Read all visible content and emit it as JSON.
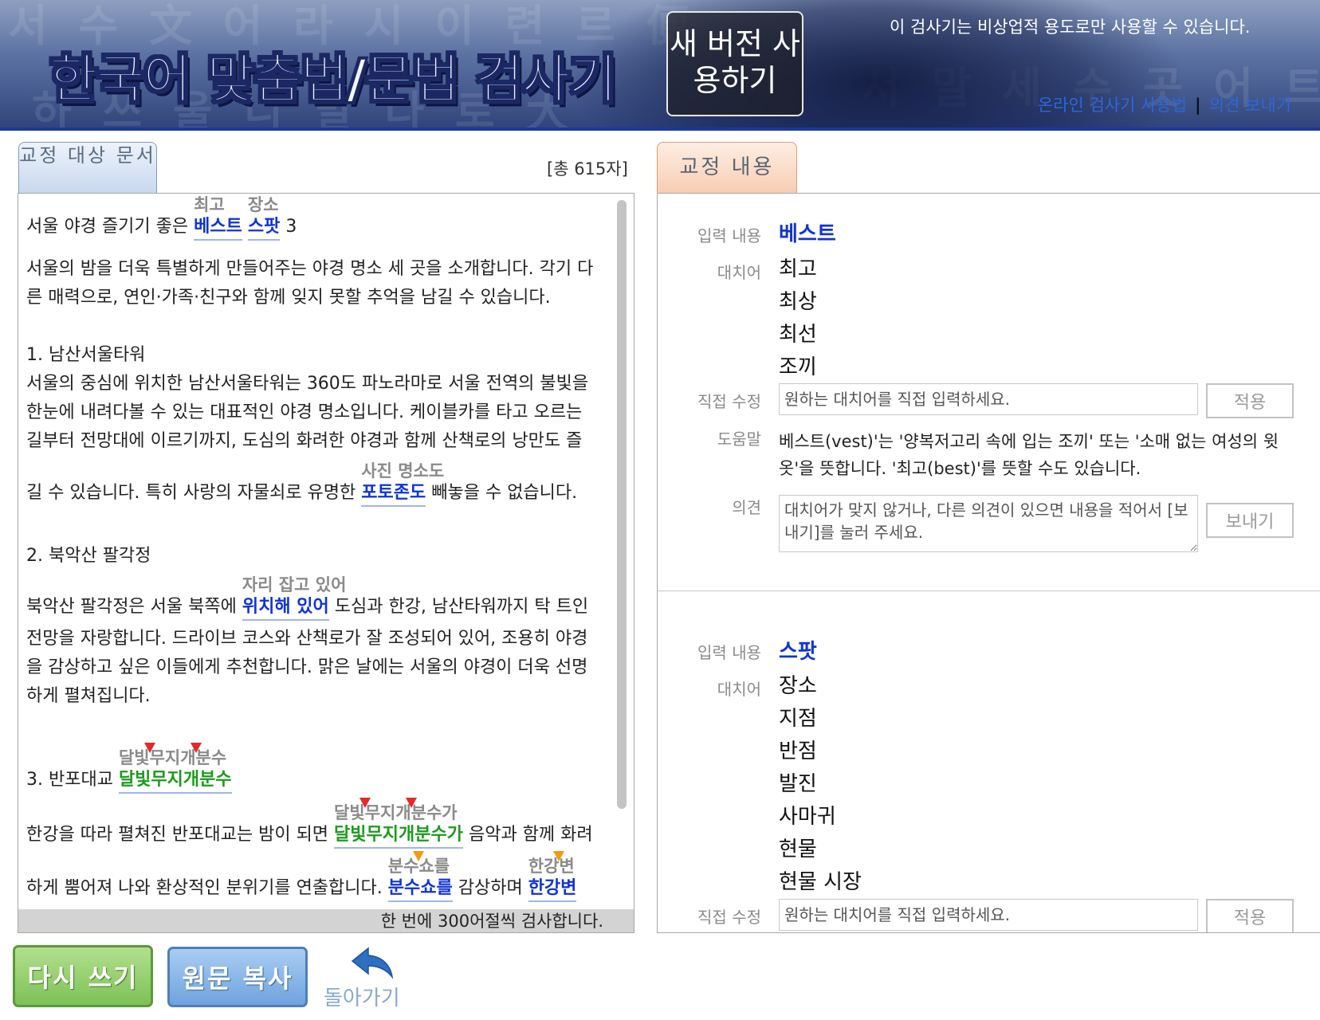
{
  "header": {
    "title": "한국어 맞춤법/문법 검사기",
    "new_version_button": "새 버전 사용하기",
    "notice": "이 검사기는 비상업적 용도로만 사용할 수 있습니다.",
    "links": {
      "usage": "온라인 검사기 사용법",
      "separator": "|",
      "feedback": "의견 보내기"
    },
    "background_text": [
      "서 수 文 어 라 시 이 련 르 便",
      "하 쓰 울 니 말 다 로 大",
      "서 말 세 수 곳 어 트 편"
    ]
  },
  "left": {
    "tab_label": "교정 대상 문서",
    "char_count": "[총 615자]",
    "footer": "한 번에 300어절씩 검사합니다.",
    "lines": {
      "l1_pre": "서울 야경 즐기기 좋은 ",
      "l1_err1": "베스트",
      "l1_sug1": "최고",
      "l1_mid": " ",
      "l1_err2": "스팟",
      "l1_sug2": "장소",
      "l1_post": " 3",
      "l2": "서울의 밤을 더욱 특별하게 만들어주는 야경 명소 세 곳을 소개합니다. 각기 다",
      "l3": "른 매력으로, 연인·가족·친구와 함께 잊지 못할 추억을 남길 수 있습니다.",
      "l4": "1. 남산서울타워",
      "l5": "서울의 중심에 위치한 남산서울타워는 360도 파노라마로 서울 전역의 불빛을",
      "l6": "한눈에 내려다볼 수 있는 대표적인 야경 명소입니다. 케이블카를 타고 오르는",
      "l7": "길부터 전망대에 이르기까지, 도심의 화려한 야경과 함께 산책로의 낭만도 즐",
      "l8_pre": "길 수 있습니다. 특히 사랑의 자물쇠로 유명한 ",
      "l8_err": "포토존도",
      "l8_sug": "사진 명소도",
      "l8_post": " 빼놓을 수 없습니다.",
      "l9": "2. 북악산 팔각정",
      "l10_pre": "북악산 팔각정은 서울 북쪽에 ",
      "l10_err": "위치해 있어",
      "l10_sug": "자리 잡고 있어",
      "l10_post": " 도심과 한강, 남산타워까지 탁 트인",
      "l11": "전망을 자랑합니다. 드라이브 코스와 산책로가 잘 조성되어 있어, 조용히 야경",
      "l12": "을 감상하고 싶은 이들에게 추천합니다. 맑은 날에는 서울의 야경이 더욱 선명",
      "l13": "하게 펼쳐집니다.",
      "l14_pre": "3. 반포대교 ",
      "l14_err": "달빛무지개분수",
      "l14_sug_a": "달빛",
      "l14_sug_b": "무지개",
      "l14_sug_c": "분수",
      "l15_pre": "한강을 따라 펼쳐진 반포대교는 밤이 되면 ",
      "l15_err": "달빛무지개분수가",
      "l15_sug_a": "달빛",
      "l15_sug_b": "무지개",
      "l15_sug_c": "분수가",
      "l15_post": " 음악과 함께 화려",
      "l16_pre": "하게 뿜어져 나와 환상적인 분위기를 연출합니다. ",
      "l16_err1": "분수쇼를",
      "l16_sug1_a": "분수",
      "l16_sug1_b": "쇼를",
      "l16_mid": " 감상하며 ",
      "l16_err2": "한강변",
      "l16_sug2_a": "한강",
      "l16_sug2_b": "변"
    }
  },
  "right": {
    "tab_label": "교정 내용",
    "labels": {
      "input": "입력 내용",
      "alternatives": "대치어",
      "direct_edit": "직접 수정",
      "help": "도움말",
      "opinion": "의견"
    },
    "apply_button": "적용",
    "send_button": "보내기",
    "direct_placeholder": "원하는 대치어를 직접 입력하세요.",
    "opinion_placeholder": "대치어가 맞지 않거나, 다른 의견이 있으면 내용을 적어서 [보내기]를 눌러 주세요.",
    "entries": [
      {
        "input": "베스트",
        "alternatives": [
          "최고",
          "최상",
          "최선",
          "조끼"
        ],
        "help": "베스트(vest)'는 '양복저고리 속에 입는 조끼' 또는 '소매 없는 여성의 윗옷'을 뜻합니다. '최고(best)'를 뜻할 수도 있습니다."
      },
      {
        "input": "스팟",
        "alternatives": [
          "장소",
          "지점",
          "반점",
          "발진",
          "사마귀",
          "현물",
          "현물 시장"
        ]
      }
    ]
  },
  "bottom": {
    "rewrite_button": "다시 쓰기",
    "copy_button": "원문 복사",
    "back_button": "돌아가기"
  },
  "colors": {
    "header_rule": "#1b3a93",
    "error_blue": "#1033d6",
    "error_green": "#1e9a1e",
    "marker_red": "#e22a2a",
    "marker_orange": "#f39a12",
    "link_blue": "#2c67d8"
  }
}
